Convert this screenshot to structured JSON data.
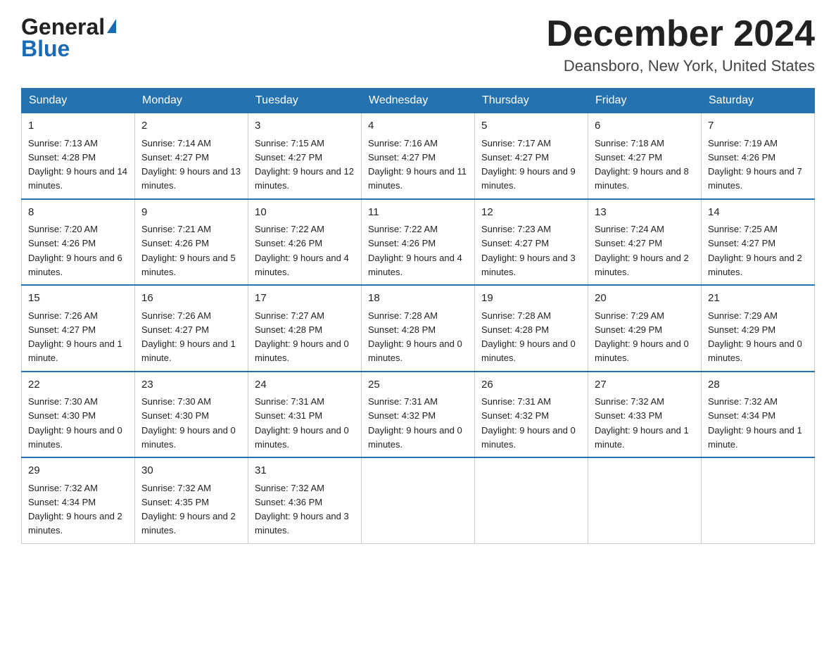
{
  "logo": {
    "text_general": "General",
    "text_blue": "Blue"
  },
  "title": "December 2024",
  "location": "Deansboro, New York, United States",
  "days_of_week": [
    "Sunday",
    "Monday",
    "Tuesday",
    "Wednesday",
    "Thursday",
    "Friday",
    "Saturday"
  ],
  "weeks": [
    [
      {
        "num": "1",
        "sunrise": "7:13 AM",
        "sunset": "4:28 PM",
        "daylight": "9 hours and 14 minutes."
      },
      {
        "num": "2",
        "sunrise": "7:14 AM",
        "sunset": "4:27 PM",
        "daylight": "9 hours and 13 minutes."
      },
      {
        "num": "3",
        "sunrise": "7:15 AM",
        "sunset": "4:27 PM",
        "daylight": "9 hours and 12 minutes."
      },
      {
        "num": "4",
        "sunrise": "7:16 AM",
        "sunset": "4:27 PM",
        "daylight": "9 hours and 11 minutes."
      },
      {
        "num": "5",
        "sunrise": "7:17 AM",
        "sunset": "4:27 PM",
        "daylight": "9 hours and 9 minutes."
      },
      {
        "num": "6",
        "sunrise": "7:18 AM",
        "sunset": "4:27 PM",
        "daylight": "9 hours and 8 minutes."
      },
      {
        "num": "7",
        "sunrise": "7:19 AM",
        "sunset": "4:26 PM",
        "daylight": "9 hours and 7 minutes."
      }
    ],
    [
      {
        "num": "8",
        "sunrise": "7:20 AM",
        "sunset": "4:26 PM",
        "daylight": "9 hours and 6 minutes."
      },
      {
        "num": "9",
        "sunrise": "7:21 AM",
        "sunset": "4:26 PM",
        "daylight": "9 hours and 5 minutes."
      },
      {
        "num": "10",
        "sunrise": "7:22 AM",
        "sunset": "4:26 PM",
        "daylight": "9 hours and 4 minutes."
      },
      {
        "num": "11",
        "sunrise": "7:22 AM",
        "sunset": "4:26 PM",
        "daylight": "9 hours and 4 minutes."
      },
      {
        "num": "12",
        "sunrise": "7:23 AM",
        "sunset": "4:27 PM",
        "daylight": "9 hours and 3 minutes."
      },
      {
        "num": "13",
        "sunrise": "7:24 AM",
        "sunset": "4:27 PM",
        "daylight": "9 hours and 2 minutes."
      },
      {
        "num": "14",
        "sunrise": "7:25 AM",
        "sunset": "4:27 PM",
        "daylight": "9 hours and 2 minutes."
      }
    ],
    [
      {
        "num": "15",
        "sunrise": "7:26 AM",
        "sunset": "4:27 PM",
        "daylight": "9 hours and 1 minute."
      },
      {
        "num": "16",
        "sunrise": "7:26 AM",
        "sunset": "4:27 PM",
        "daylight": "9 hours and 1 minute."
      },
      {
        "num": "17",
        "sunrise": "7:27 AM",
        "sunset": "4:28 PM",
        "daylight": "9 hours and 0 minutes."
      },
      {
        "num": "18",
        "sunrise": "7:28 AM",
        "sunset": "4:28 PM",
        "daylight": "9 hours and 0 minutes."
      },
      {
        "num": "19",
        "sunrise": "7:28 AM",
        "sunset": "4:28 PM",
        "daylight": "9 hours and 0 minutes."
      },
      {
        "num": "20",
        "sunrise": "7:29 AM",
        "sunset": "4:29 PM",
        "daylight": "9 hours and 0 minutes."
      },
      {
        "num": "21",
        "sunrise": "7:29 AM",
        "sunset": "4:29 PM",
        "daylight": "9 hours and 0 minutes."
      }
    ],
    [
      {
        "num": "22",
        "sunrise": "7:30 AM",
        "sunset": "4:30 PM",
        "daylight": "9 hours and 0 minutes."
      },
      {
        "num": "23",
        "sunrise": "7:30 AM",
        "sunset": "4:30 PM",
        "daylight": "9 hours and 0 minutes."
      },
      {
        "num": "24",
        "sunrise": "7:31 AM",
        "sunset": "4:31 PM",
        "daylight": "9 hours and 0 minutes."
      },
      {
        "num": "25",
        "sunrise": "7:31 AM",
        "sunset": "4:32 PM",
        "daylight": "9 hours and 0 minutes."
      },
      {
        "num": "26",
        "sunrise": "7:31 AM",
        "sunset": "4:32 PM",
        "daylight": "9 hours and 0 minutes."
      },
      {
        "num": "27",
        "sunrise": "7:32 AM",
        "sunset": "4:33 PM",
        "daylight": "9 hours and 1 minute."
      },
      {
        "num": "28",
        "sunrise": "7:32 AM",
        "sunset": "4:34 PM",
        "daylight": "9 hours and 1 minute."
      }
    ],
    [
      {
        "num": "29",
        "sunrise": "7:32 AM",
        "sunset": "4:34 PM",
        "daylight": "9 hours and 2 minutes."
      },
      {
        "num": "30",
        "sunrise": "7:32 AM",
        "sunset": "4:35 PM",
        "daylight": "9 hours and 2 minutes."
      },
      {
        "num": "31",
        "sunrise": "7:32 AM",
        "sunset": "4:36 PM",
        "daylight": "9 hours and 3 minutes."
      },
      null,
      null,
      null,
      null
    ]
  ]
}
